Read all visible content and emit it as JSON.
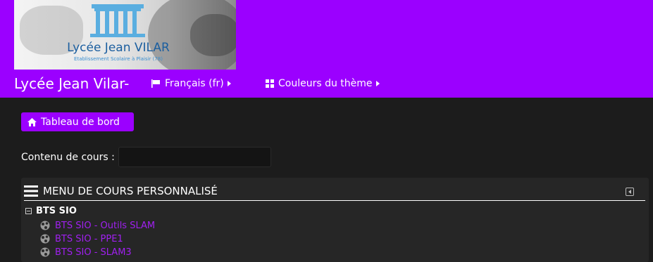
{
  "header": {
    "logo_name": "Lycée Jean VILAR",
    "logo_subtitle": "Etablissement Scolaire à Plaisir (78)",
    "site_title": "Lycée Jean Vilar-",
    "nav": [
      {
        "label": "Français (fr)",
        "icon": "flag-icon"
      },
      {
        "label": "Couleurs du thème",
        "icon": "grid-icon"
      }
    ]
  },
  "dashboard_button": {
    "label": "Tableau de bord",
    "icon": "home-icon"
  },
  "search": {
    "label": "Contenu de cours :",
    "value": ""
  },
  "course_menu": {
    "title": "MENU DE COURS PERSONNALISÉ",
    "category": "BTS SIO",
    "courses": [
      "BTS SIO - Outils SLAM",
      "BTS SIO - PPE1",
      "BTS SIO - SLAM3"
    ]
  },
  "colors": {
    "accent": "#9b00ff",
    "background": "#1c1c1c",
    "link": "#a020f0"
  }
}
